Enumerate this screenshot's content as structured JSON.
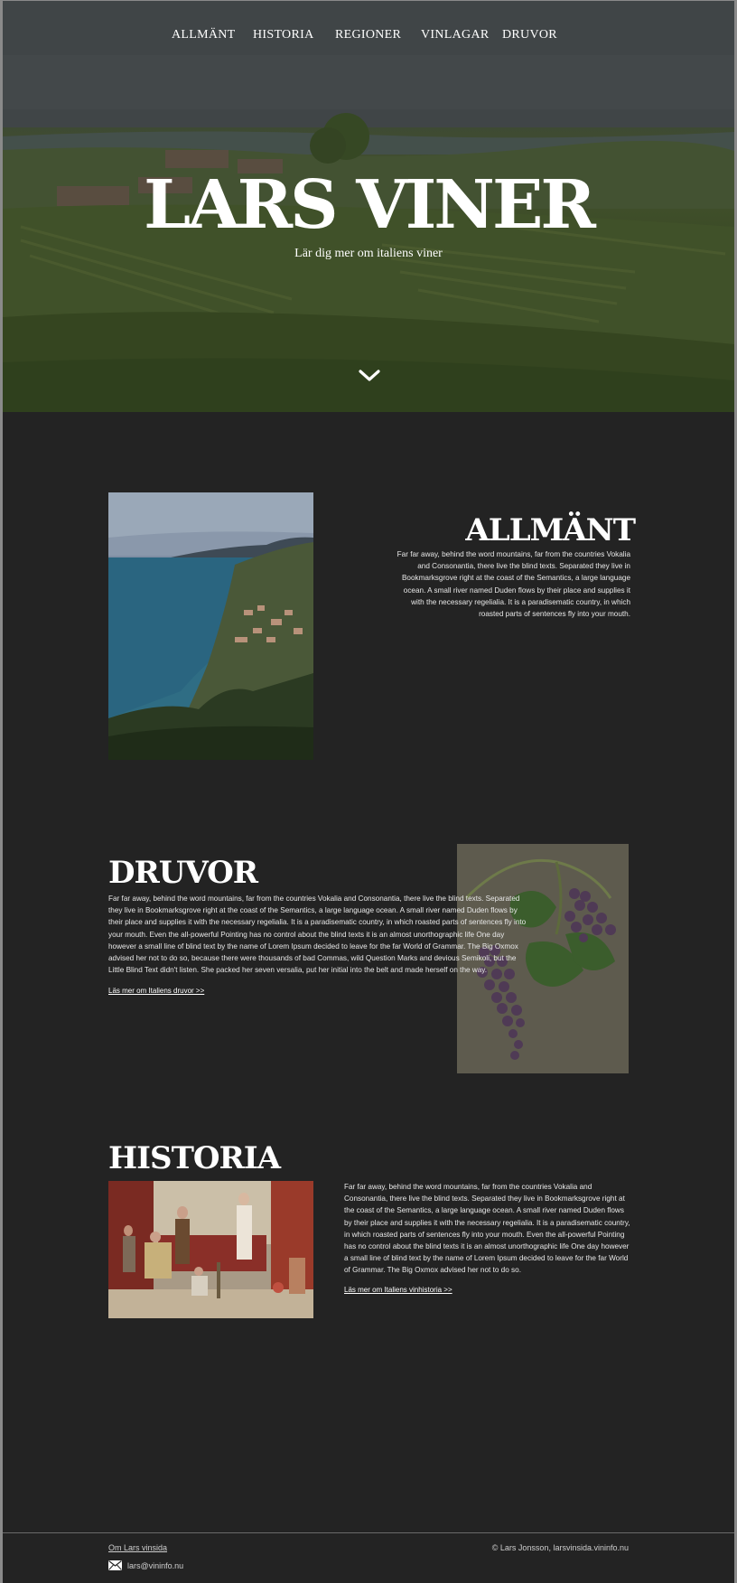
{
  "nav": {
    "items": [
      {
        "label": "ALLMÄNT"
      },
      {
        "label": "HISTORIA"
      },
      {
        "label": "REGIONER"
      },
      {
        "label": "VINLAGAR"
      },
      {
        "label": "DRUVOR"
      }
    ]
  },
  "hero": {
    "title": "LARS VINER",
    "subtitle": "Lär dig mer om italiens viner",
    "scroll_icon": "chevron-down-icon"
  },
  "allmant": {
    "title": "ALLMÄNT",
    "text": "Far far away, behind the word mountains, far from the countries Vokalia and Consonantia, there live the blind texts. Separated they live in Bookmarksgrove right at the coast of the Semantics, a large language ocean. A small river named Duden flows by their place and supplies it with the necessary regelialia. It is a paradisematic country, in which roasted parts of sentences fly into your mouth."
  },
  "druvor": {
    "title": "DRUVOR",
    "text": "Far far away, behind the word mountains, far from the countries Vokalia and Consonantia, there live the blind texts. Separated they live in Bookmarksgrove right at the coast of the Semantics, a large language ocean. A small river named Duden flows by their place and supplies it with the necessary regelialia. It is a paradisematic country, in which roasted parts of sentences fly into your mouth. Even the all-powerful Pointing has no control about the blind texts it is an almost unorthographic life One day however a small line of blind text by the name of Lorem Ipsum decided to leave for the far World of Grammar. The Big Oxmox advised her not to do so, because there were thousands of bad Commas, wild Question Marks and devious Semikoli, but the Little Blind Text didn't listen. She packed her seven versalia, put her initial into the belt and made herself on the way.",
    "link": "Läs mer om Italiens druvor >>"
  },
  "historia": {
    "title": "HISTORIA",
    "text": "Far far away, behind the word mountains, far from the countries Vokalia and Consonantia, there live the blind texts. Separated they live in Bookmarksgrove right at the coast of the Semantics, a large language ocean. A small river named Duden flows by their place and supplies it with the necessary regelialia. It is a paradisematic country, in which roasted parts of sentences fly into your mouth. Even the all-powerful Pointing has no control about the blind texts it is an almost unorthographic life One day however a small line of blind text by the name of Lorem Ipsum decided to leave for the far World of Grammar. The Big Oxmox advised her not to do so.",
    "link": "Läs mer om Italiens vinhistoria >>"
  },
  "footer": {
    "about_link": "Om Lars vinsida",
    "email": "lars@vininfo.nu",
    "email_icon": "envelope-icon",
    "copyright": "© Lars Jonsson, larsvinsida.vininfo.nu"
  }
}
